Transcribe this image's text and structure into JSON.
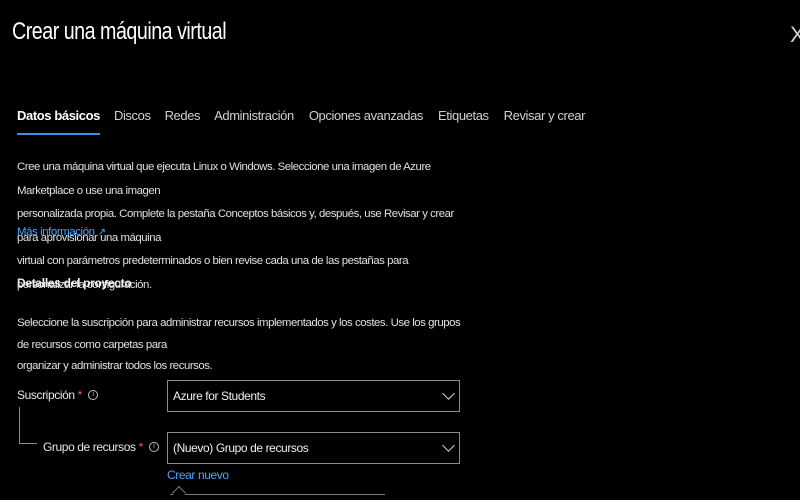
{
  "header": {
    "title": "Crear una máquina virtual",
    "more_label": "···",
    "close_label": "X"
  },
  "tabs": [
    {
      "label": "Datos básicos",
      "active": true
    },
    {
      "label": "Discos"
    },
    {
      "label": "Redes"
    },
    {
      "label": "Administración"
    },
    {
      "label": "Opciones avanzadas"
    },
    {
      "label": "Etiquetas"
    },
    {
      "label": "Revisar y crear"
    }
  ],
  "intro": {
    "lines": [
      "Cree una máquina virtual que ejecuta Linux o Windows. Seleccione una imagen de Azure Marketplace o use una imagen",
      "personalizada propia. Complete la pestaña Conceptos básicos y, después, use Revisar y crear para aprovisionar una máquina",
      "virtual con parámetros predeterminados o bien revise cada una de las pestañas para personalizar la configuración."
    ],
    "link_label": "Más información",
    "link_icon": "external-link-icon"
  },
  "project": {
    "title": "Detalles del proyecto",
    "lines": [
      "Seleccione la suscripción para administrar recursos implementados y los costes. Use los grupos de recursos como carpetas para",
      "organizar y administrar todos los recursos."
    ],
    "subscription": {
      "label": "Suscripción",
      "required": "*",
      "info": "i",
      "value": "Azure for Students"
    },
    "resource_group": {
      "label": "Grupo de recursos",
      "required": "*",
      "info": "i",
      "value": "(Nuevo) Grupo de recursos",
      "create_new_label": "Crear nuevo"
    }
  },
  "colors": {
    "background": "#000000",
    "accent": "#3a8ee6",
    "link": "#4ea3ff",
    "required": "#ff5a5a"
  }
}
